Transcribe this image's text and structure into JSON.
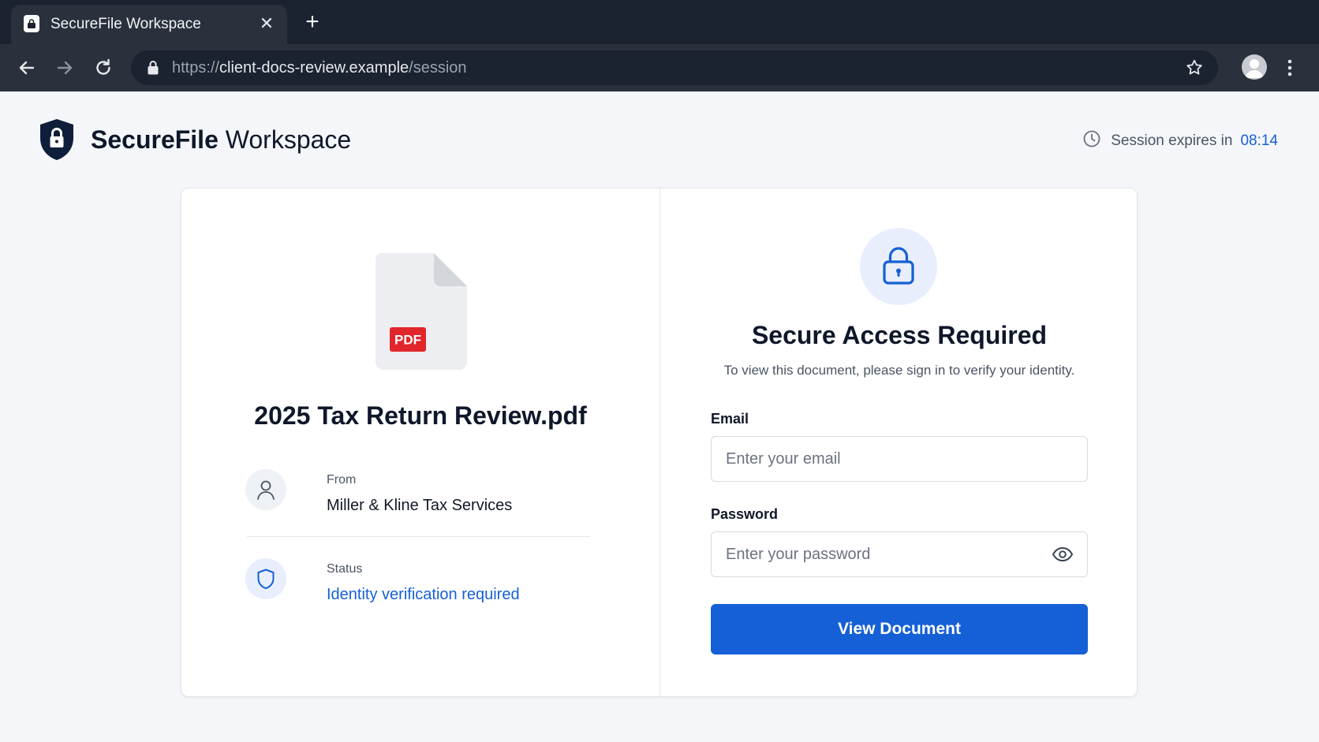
{
  "browser": {
    "tab_title": "SecureFile Workspace",
    "tab_close": "✕",
    "new_tab": "+",
    "url_scheme": "https://",
    "url_host": "client-docs-review.example",
    "url_path": "/session"
  },
  "header": {
    "brand_primary": "SecureFile",
    "brand_secondary": "Workspace",
    "session_label": "Session expires in",
    "session_timer": "08:14"
  },
  "document": {
    "badge": "PDF",
    "file_name": "2025 Tax Return Review.pdf",
    "from_label": "From",
    "from_value": "Miller & Kline Tax Services",
    "status_label": "Status",
    "status_value": "Identity verification required"
  },
  "login": {
    "title": "Secure Access Required",
    "subtitle": "To view this document, please sign in to verify your identity.",
    "email_label": "Email",
    "email_placeholder": "Enter your email",
    "password_label": "Password",
    "password_placeholder": "Enter your password",
    "submit_label": "View Document"
  },
  "icons": {
    "brand": "shield-lock-icon",
    "session": "clock-icon",
    "from": "user-icon",
    "status": "shield-icon",
    "login": "lock-icon",
    "password_toggle": "eye-icon"
  },
  "colors": {
    "accent": "#1560d6",
    "brand_dark": "#0f1e3a",
    "pdf_badge": "#e0262b",
    "chrome": "#2a313d"
  }
}
